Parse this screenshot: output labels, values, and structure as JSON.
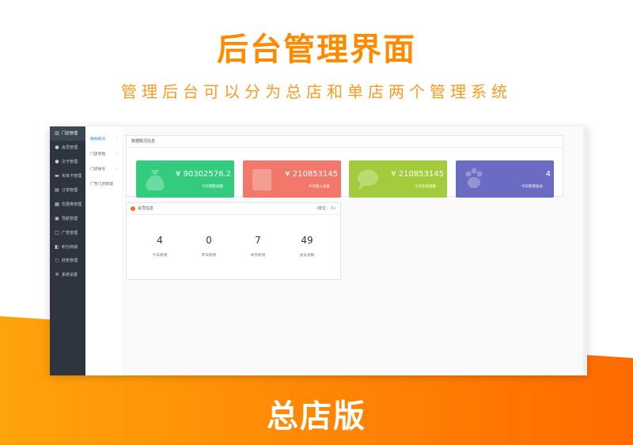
{
  "banner": {
    "title": "后台管理界面",
    "subtitle": "管理后台可以分为总店和单店两个管理系统",
    "footer_title": "总店版"
  },
  "sidebar": {
    "items": [
      {
        "label": "门店管理",
        "icon": "store-icon",
        "active": true
      },
      {
        "label": "会员管理",
        "icon": "user-icon"
      },
      {
        "label": "次卡管理",
        "icon": "user-icon"
      },
      {
        "label": "实体卡管理",
        "icon": "card-icon"
      },
      {
        "label": "订单管理",
        "icon": "document-icon"
      },
      {
        "label": "优惠券管理",
        "icon": "coupon-icon"
      },
      {
        "label": "导航管理",
        "icon": "navigation-icon"
      },
      {
        "label": "广告管理",
        "icon": "ad-icon"
      },
      {
        "label": "积分商城",
        "icon": "mall-icon"
      },
      {
        "label": "财务管理",
        "icon": "finance-icon"
      },
      {
        "label": "系统设置",
        "icon": "gear-icon"
      }
    ]
  },
  "subnav": {
    "items": [
      {
        "label": "数据概况",
        "active": true
      },
      {
        "label": "门店管理"
      },
      {
        "label": "门店账号"
      },
      {
        "label": "广告门店管理"
      }
    ]
  },
  "overview": {
    "header": "数据概况信息",
    "cards": [
      {
        "value": "¥ 90302576.2",
        "label": "今日销售总额",
        "color": "#33cc7f",
        "icon": "money-bag-icon"
      },
      {
        "value": "¥ 210853145",
        "label": "今日收入总金",
        "color": "#f1786a",
        "icon": "document-icon"
      },
      {
        "value": "¥ 210853145",
        "label": "今日充值金额",
        "color": "#a2cc3b",
        "icon": "chat-bubble-icon"
      },
      {
        "value": "4",
        "label": "今日新增会员",
        "color": "#6a6bc2",
        "icon": "paw-icon"
      }
    ]
  },
  "members": {
    "header": "会员信息",
    "unit": "(单位：人)",
    "icon_color": "#ff6a2b",
    "stats": [
      {
        "value": "4",
        "label": "今日新增"
      },
      {
        "value": "0",
        "label": "昨日新增"
      },
      {
        "value": "7",
        "label": "本月新增"
      },
      {
        "value": "49",
        "label": "会员总数"
      }
    ]
  }
}
